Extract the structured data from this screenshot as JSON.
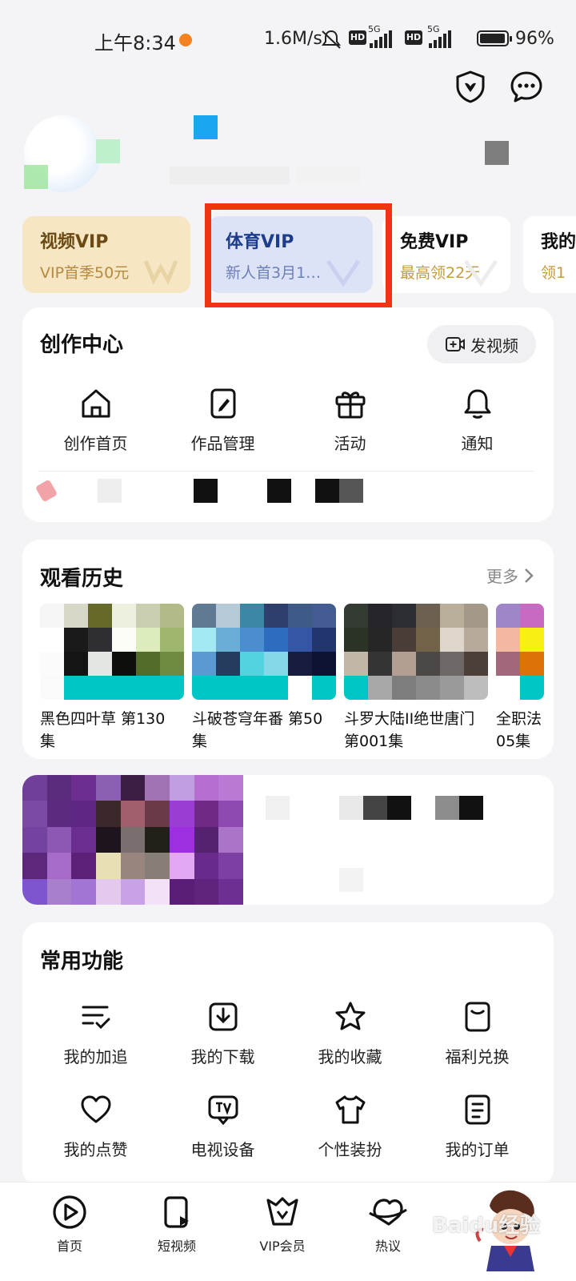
{
  "status_bar": {
    "time": "上午8:34",
    "net_speed": "1.6M/s",
    "network_type": "5G",
    "hd_badge": "HD",
    "battery": "96%"
  },
  "header_icons": [
    "shield-icon",
    "message-icon"
  ],
  "vip_cards": [
    {
      "title": "视频VIP",
      "subtitle": "VIP首季50元",
      "title_color": "#6b4a14",
      "subtitle_color": "#b58a3c",
      "bg": "#f6e6c4"
    },
    {
      "title": "体育VIP",
      "subtitle": "新人首3月1…",
      "title_color": "#1e3c8c",
      "subtitle_color": "#6d7fb8",
      "bg": "#dde3f7"
    },
    {
      "title": "免费VIP",
      "subtitle": "最高领22天",
      "title_color": "#111111",
      "subtitle_color": "#c69a3e",
      "bg": "#ffffff"
    },
    {
      "title": "我的",
      "subtitle": "领1",
      "title_color": "#111111",
      "subtitle_color": "#c69a3e",
      "bg": "#ffffff"
    }
  ],
  "creation": {
    "title": "创作中心",
    "post_button": "发视频",
    "items": [
      {
        "label": "创作首页",
        "icon": "home-icon"
      },
      {
        "label": "作品管理",
        "icon": "edit-icon"
      },
      {
        "label": "活动",
        "icon": "gift-icon"
      },
      {
        "label": "通知",
        "icon": "bell-icon"
      }
    ]
  },
  "history": {
    "title": "观看历史",
    "more": "更多",
    "items": [
      {
        "line1": "黑色四叶草 第130",
        "line2": "集"
      },
      {
        "line1": "斗破苍穹年番 第50",
        "line2": "集"
      },
      {
        "line1": "斗罗大陆II绝世唐门",
        "line2": "第001集"
      },
      {
        "line1": "全职法",
        "line2": "05集"
      }
    ]
  },
  "common": {
    "title": "常用功能",
    "items": [
      {
        "label": "我的加追",
        "icon": "list-check-icon"
      },
      {
        "label": "我的下载",
        "icon": "download-icon"
      },
      {
        "label": "我的收藏",
        "icon": "star-icon"
      },
      {
        "label": "福利兑换",
        "icon": "coupon-icon"
      },
      {
        "label": "我的点赞",
        "icon": "heart-icon"
      },
      {
        "label": "电视设备",
        "icon": "tv-icon"
      },
      {
        "label": "个性装扮",
        "icon": "tshirt-icon"
      },
      {
        "label": "我的订单",
        "icon": "order-icon"
      }
    ]
  },
  "tabbar": [
    {
      "label": "首页",
      "icon": "play-icon"
    },
    {
      "label": "短视频",
      "icon": "short-video-icon"
    },
    {
      "label": "VIP会员",
      "icon": "vip-crown-icon"
    },
    {
      "label": "热议",
      "icon": "chat-planet-icon"
    }
  ],
  "watermark": "Baidu经验"
}
